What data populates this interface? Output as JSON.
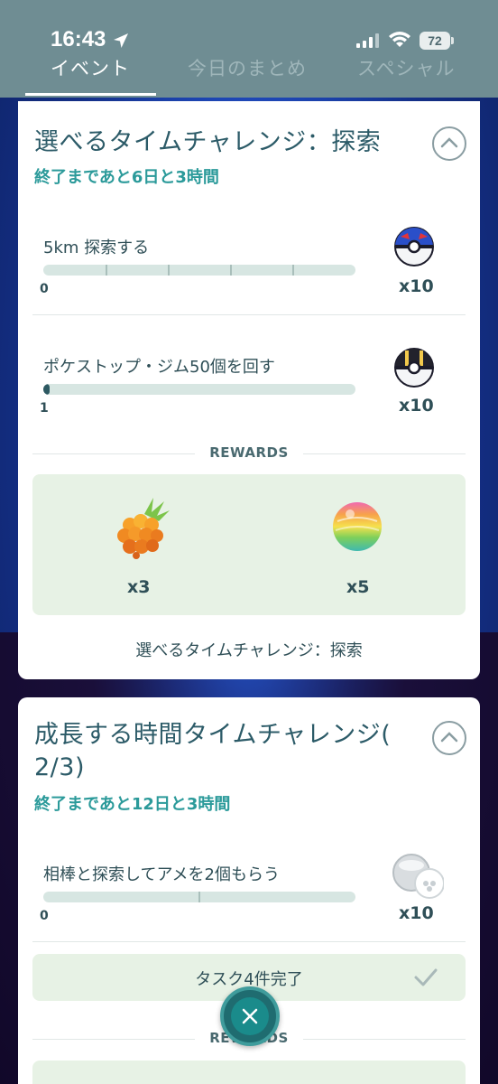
{
  "status_bar": {
    "time": "16:43",
    "battery": "72"
  },
  "tabs": [
    {
      "label": "イベント",
      "active": true
    },
    {
      "label": "今日のまとめ",
      "active": false
    },
    {
      "label": "スペシャル",
      "active": false
    }
  ],
  "card1": {
    "title": "選べるタイムチャレンジ：探索",
    "subtitle": "終了まであと6日と3時間",
    "tasks": [
      {
        "label": "5km 探索する",
        "progress_text": "0",
        "progress": 0,
        "reward_icon": "great-ball-icon",
        "reward_qty": "x10"
      },
      {
        "label": "ポケストップ・ジム50個を回す",
        "progress_text": "1",
        "progress": 0.02,
        "reward_icon": "ultra-ball-icon",
        "reward_qty": "x10"
      }
    ],
    "rewards_header": "REWARDS",
    "rewards": [
      {
        "icon": "golden-razz-berry-icon",
        "qty": "x3"
      },
      {
        "icon": "rare-candy-icon",
        "qty": "x5"
      }
    ],
    "rewards_caption": "選べるタイムチャレンジ：探索"
  },
  "card2": {
    "title_line1": "成長する時間タイムチャレンジ(",
    "title_line2": "2/3)",
    "subtitle": "終了まであと12日と3時間",
    "tasks": [
      {
        "label": "相棒と探索してアメを2個もらう",
        "progress_text": "0",
        "progress": 0,
        "reward_icon": "incubator-icon",
        "reward_qty": "x10"
      }
    ],
    "done_text": "タスク4件完了",
    "rewards_header": "REWARDS"
  },
  "colors": {
    "header_bg": "#6f8d93",
    "accent_teal": "#2b9a9a",
    "rewards_bg": "#e7f2e5"
  }
}
